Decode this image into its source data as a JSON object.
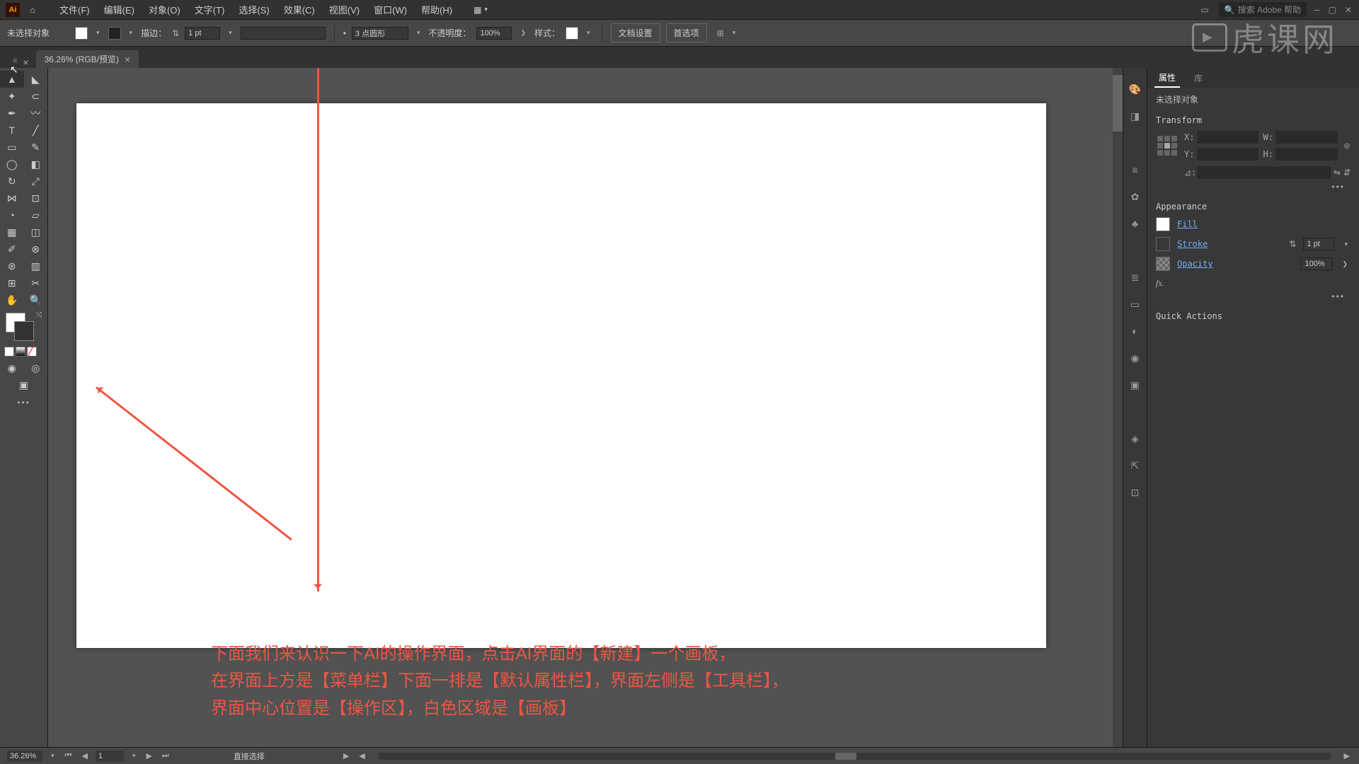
{
  "menu": {
    "file": "文件(F)",
    "edit": "编辑(E)",
    "object": "对象(O)",
    "type": "文字(T)",
    "select": "选择(S)",
    "effect": "效果(C)",
    "view": "视图(V)",
    "window": "窗口(W)",
    "help": "帮助(H)"
  },
  "search_placeholder": "搜索 Adobe 帮助",
  "control": {
    "no_selection": "未选择对象",
    "stroke_label": "描边：",
    "stroke_val": "1 pt",
    "shape_val": "3 点圆形",
    "opacity_label": "不透明度：",
    "opacity_val": "100%",
    "style_label": "样式：",
    "doc_setup": "文档设置",
    "prefs": "首选项"
  },
  "tab": {
    "title": "36.26% (RGB/预览)"
  },
  "tutorial": {
    "line1": "下面我们来认识一下AI的操作界面，点击AI界面的【新建】一个画板，",
    "line2": "在界面上方是【菜单栏】下面一排是【默认属性栏】，界面左侧是【工具栏】，",
    "line3": "界面中心位置是【操作区】，白色区域是【画板】"
  },
  "props": {
    "tab_properties": "属性",
    "tab_library": "库",
    "no_selection": "未选择对象",
    "transform": "Transform",
    "x_label": "X:",
    "y_label": "Y:",
    "w_label": "W:",
    "h_label": "H:",
    "angle_label": "⊿:",
    "appearance": "Appearance",
    "fill": "Fill",
    "stroke": "Stroke",
    "stroke_val": "1 pt",
    "opacity": "Opacity",
    "opacity_val": "100%",
    "fx": "fx.",
    "quick_actions": "Quick Actions"
  },
  "bottom": {
    "zoom": "36.26%",
    "artboard": "1",
    "tool_hint": "直接选择"
  },
  "watermark": "虎课网"
}
